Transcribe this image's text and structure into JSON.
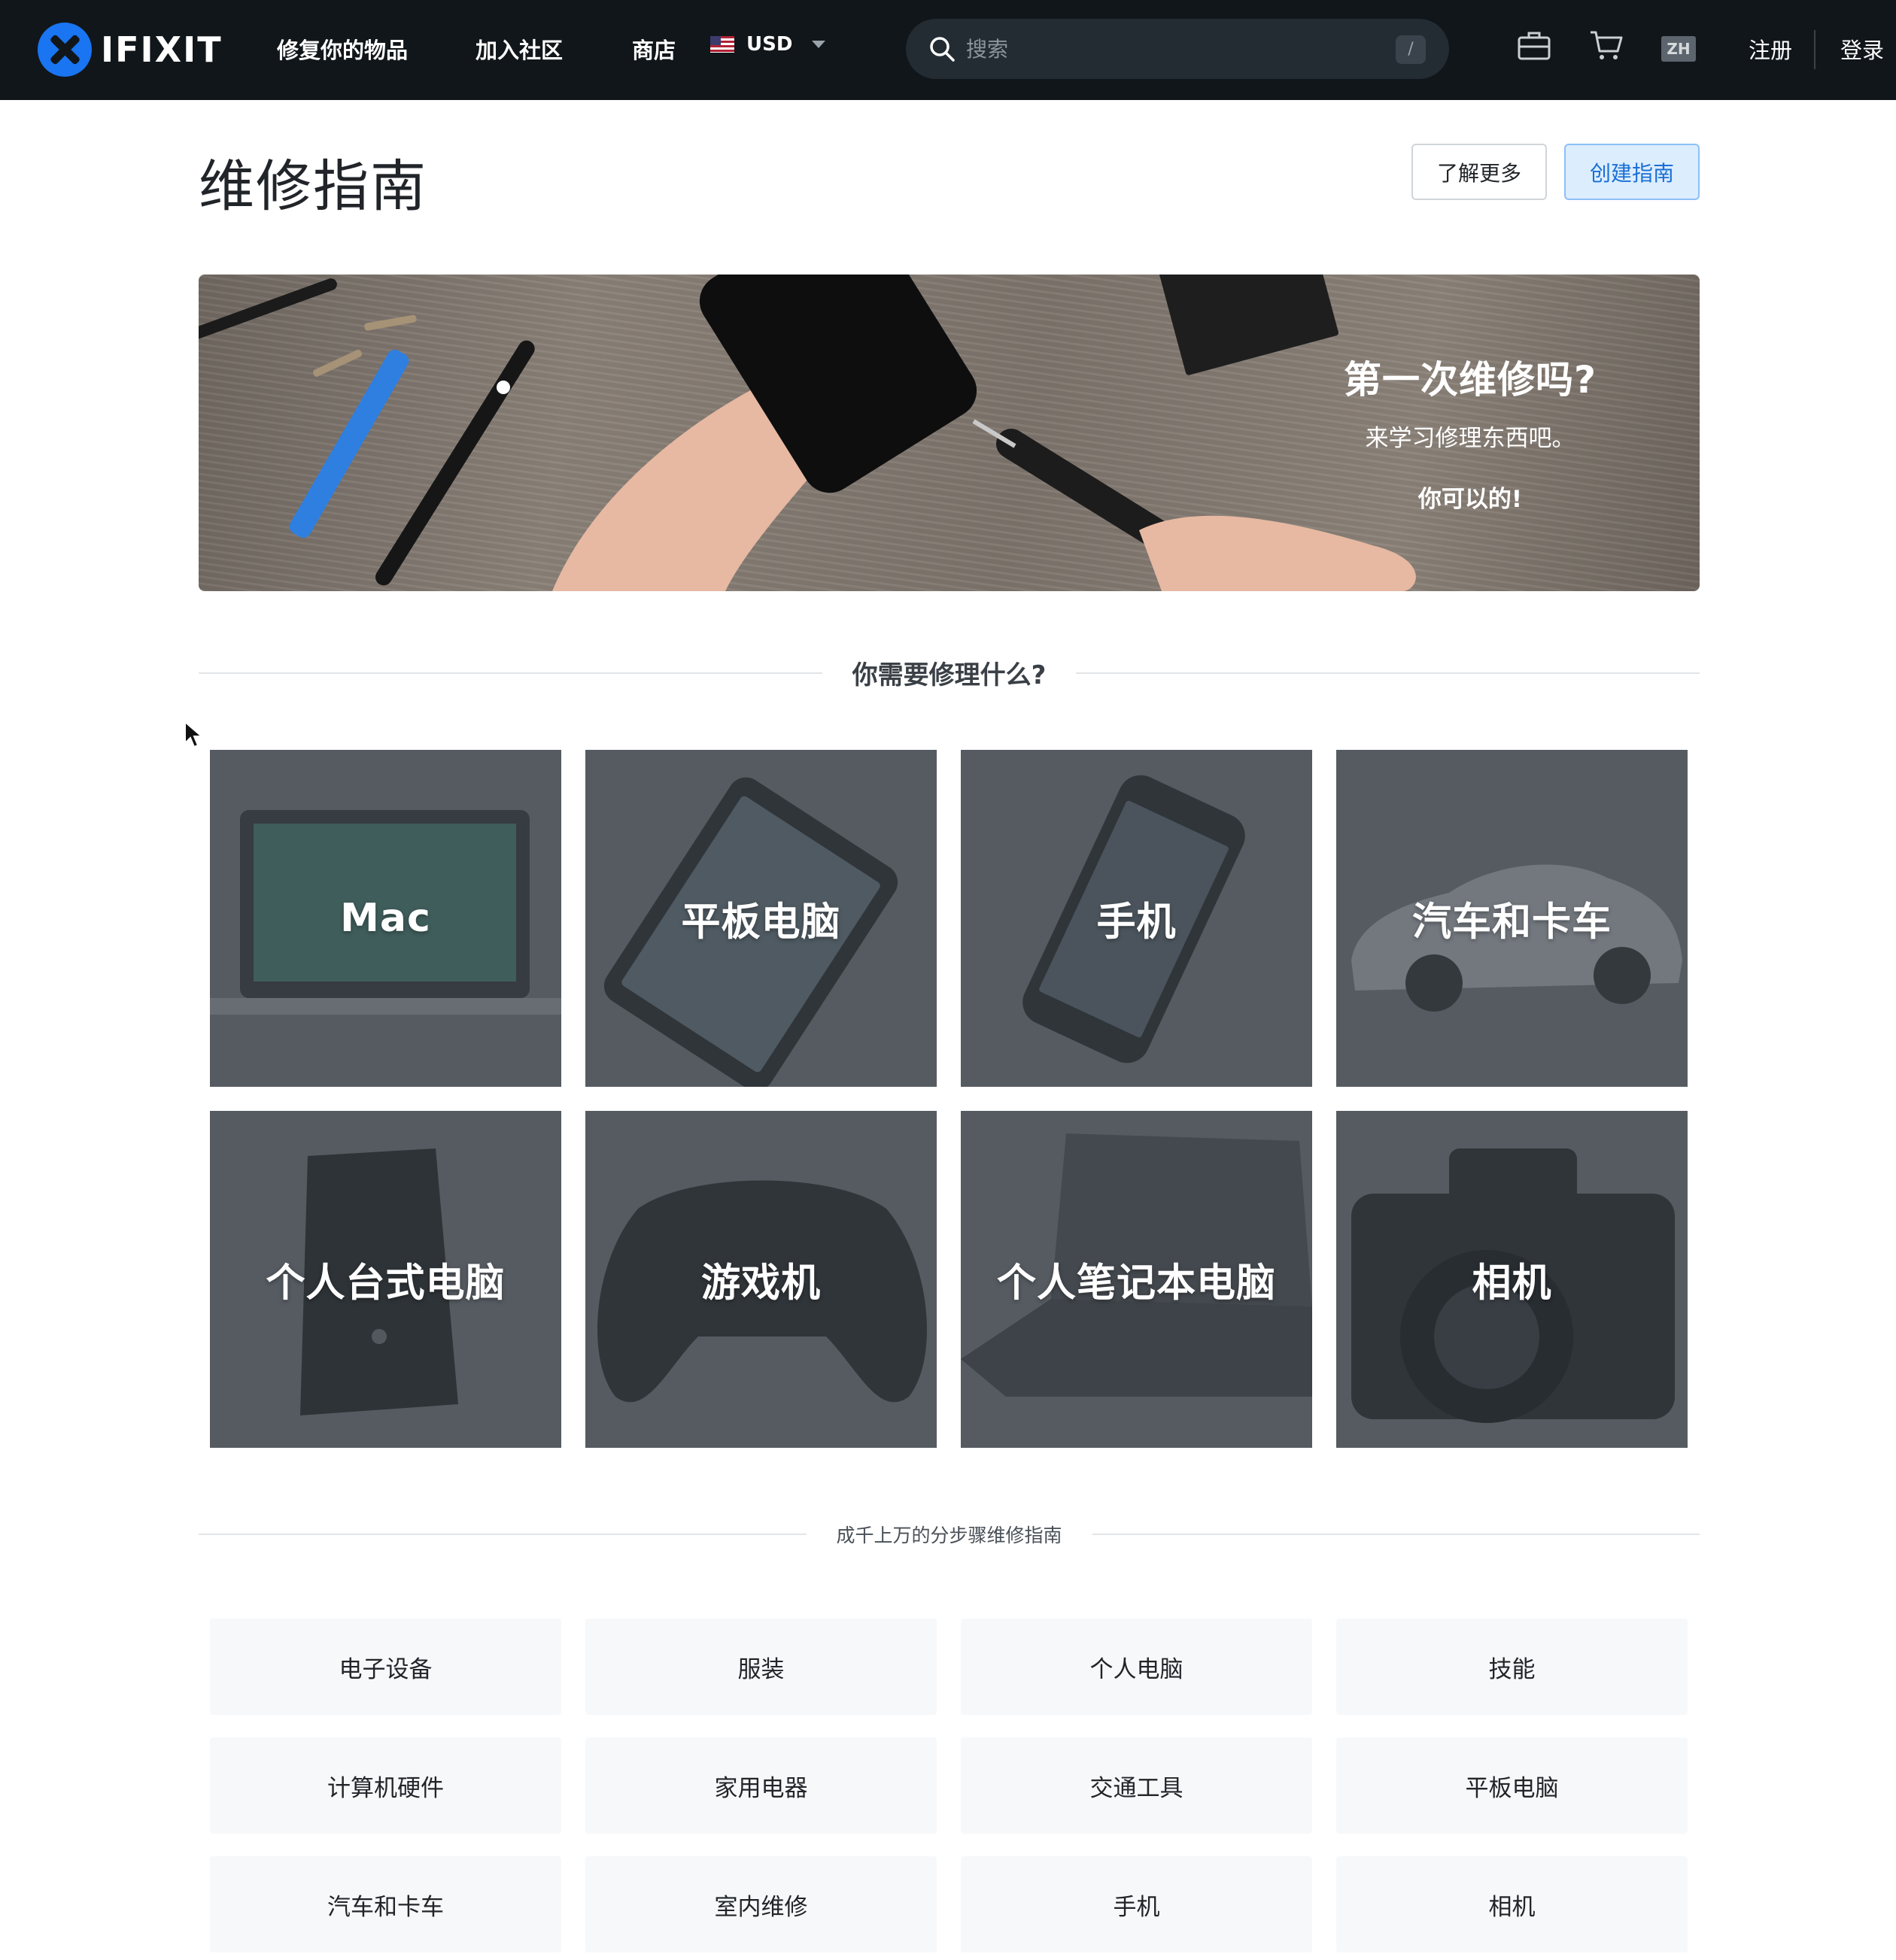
{
  "nav": {
    "logo_text": "IFIXIT",
    "links": [
      "修复你的物品",
      "加入社区",
      "商店"
    ],
    "currency": "USD",
    "search_placeholder": "搜索",
    "search_shortcut": "/",
    "lang": "ZH",
    "register": "注册",
    "login": "登录",
    "icons": [
      "toolbox-icon",
      "cart-icon"
    ]
  },
  "header": {
    "title": "维修指南",
    "learn_more": "了解更多",
    "create_guide": "创建指南"
  },
  "hero": {
    "title": "第一次维修吗?",
    "subtitle": "来学习修理东西吧。",
    "cta": "你可以的!"
  },
  "categories_heading": "你需要修理什么?",
  "categories": [
    {
      "label": "Mac",
      "icon": "laptop-mac-image"
    },
    {
      "label": "平板电脑",
      "icon": "tablet-image"
    },
    {
      "label": "手机",
      "icon": "phone-image"
    },
    {
      "label": "汽车和卡车",
      "icon": "car-image"
    },
    {
      "label": "个人台式电脑",
      "icon": "desktop-tower-image"
    },
    {
      "label": "游戏机",
      "icon": "game-controller-image"
    },
    {
      "label": "个人笔记本电脑",
      "icon": "laptop-image"
    },
    {
      "label": "相机",
      "icon": "camera-image"
    }
  ],
  "guides_heading": "成千上万的分步骤维修指南",
  "guide_links": [
    "电子设备",
    "服装",
    "个人电脑",
    "技能",
    "计算机硬件",
    "家用电器",
    "交通工具",
    "平板电脑",
    "汽车和卡车",
    "室内维修",
    "手机",
    "相机"
  ],
  "colors": {
    "nav_bg": "#11161a",
    "brand_blue": "#1975f1",
    "primary_button_bg": "#dcedfe",
    "tile_overlay": "#5a6066"
  }
}
